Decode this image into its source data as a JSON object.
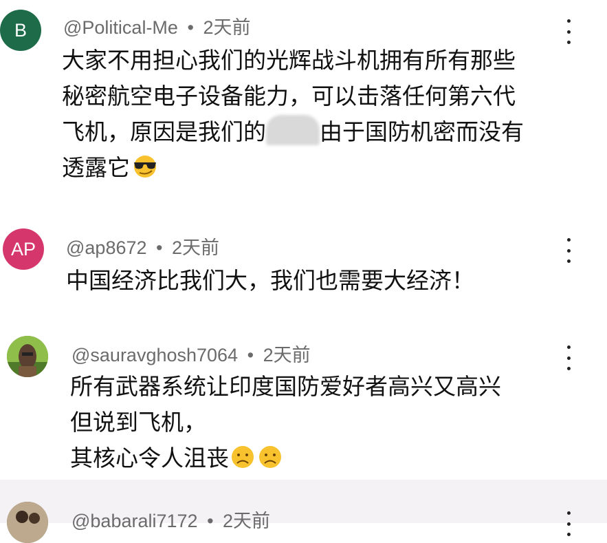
{
  "comments": [
    {
      "avatar_letter": "B",
      "avatar_color": "#1e6b4a",
      "author": "@Political-Me",
      "sep": "•",
      "time": "2天前",
      "lines": [
        "大家不用担心我们的光辉战斗机拥有所有那些",
        "秘密航空电子设备能力，可以击落任何第六代",
        "飞机，原因是我们的",
        "由于国防机密而没有",
        "透露它"
      ],
      "emoji": "smiling-face-with-sunglasses"
    },
    {
      "avatar_letter": "AP",
      "avatar_color": "#d5366b",
      "author": "@ap8672",
      "sep": "•",
      "time": "2天前",
      "lines": [
        "中国经济比我们大，我们也需要大经济！"
      ]
    },
    {
      "author": "@sauravghosh7064",
      "sep": "•",
      "time": "2天前",
      "lines": [
        "所有武器系统让印度国防爱好者高兴又高兴",
        "但说到飞机，",
        "其核心令人沮丧"
      ],
      "emoji": "frowning-face"
    },
    {
      "author": "@babarali7172",
      "sep": "•",
      "time": "2天前"
    }
  ]
}
